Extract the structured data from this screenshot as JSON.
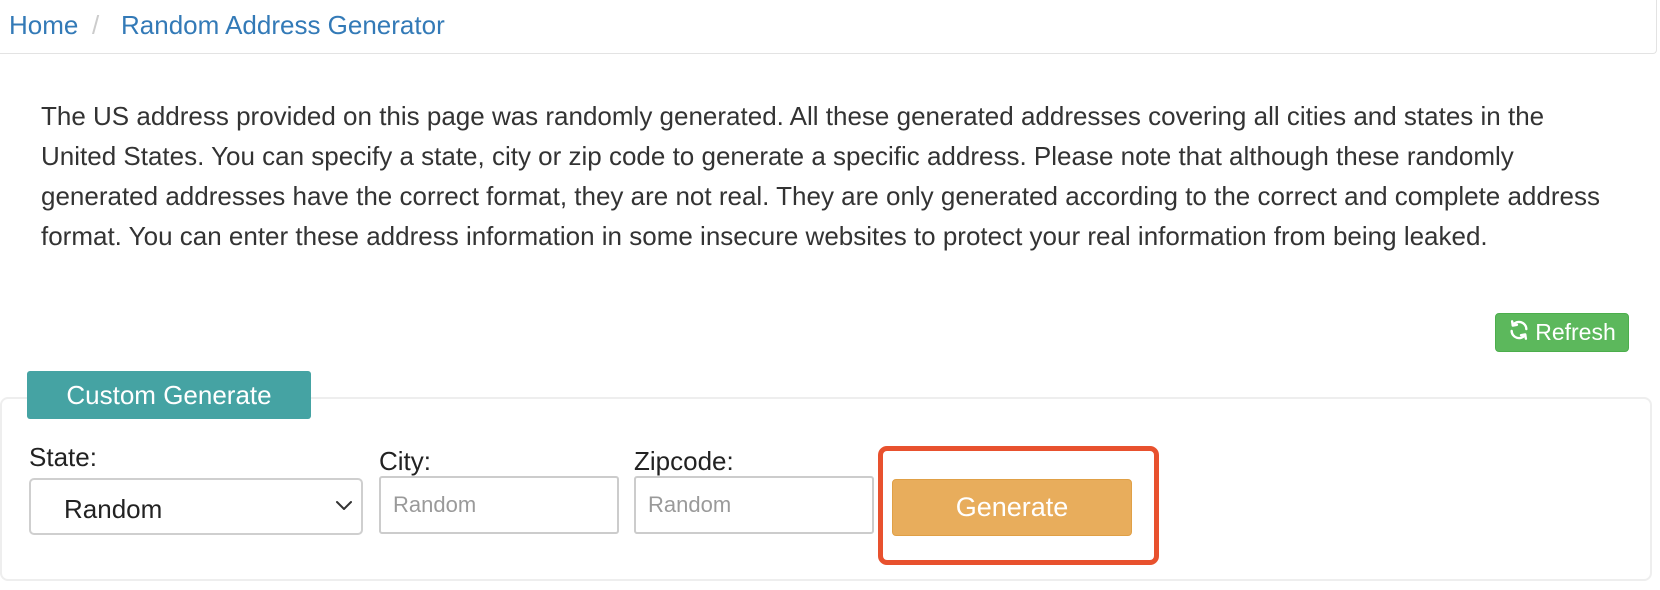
{
  "breadcrumb": {
    "home": "Home",
    "separator": "/",
    "current": "Random Address Generator"
  },
  "description": "The US address provided on this page was randomly generated. All these generated addresses covering all cities and states in the United States. You can specify a state, city or zip code to generate a specific address. Please note that although these randomly generated addresses have the correct format, they are not real. They are only generated according to the correct and complete address format. You can enter these address information in some insecure websites to protect your real information from being leaked.",
  "refresh": {
    "label": "Refresh",
    "icon": "refresh-icon",
    "color": "#5cb85c"
  },
  "custom_generate": {
    "tab_label": "Custom Generate",
    "tab_color": "#45a3a3",
    "state": {
      "label": "State:",
      "selected": "Random"
    },
    "city": {
      "label": "City:",
      "value": "",
      "placeholder": "Random"
    },
    "zipcode": {
      "label": "Zipcode:",
      "value": "",
      "placeholder": "Random"
    },
    "generate_label": "Generate",
    "generate_color": "#e8ad5c",
    "highlight_color": "#e8512e"
  }
}
